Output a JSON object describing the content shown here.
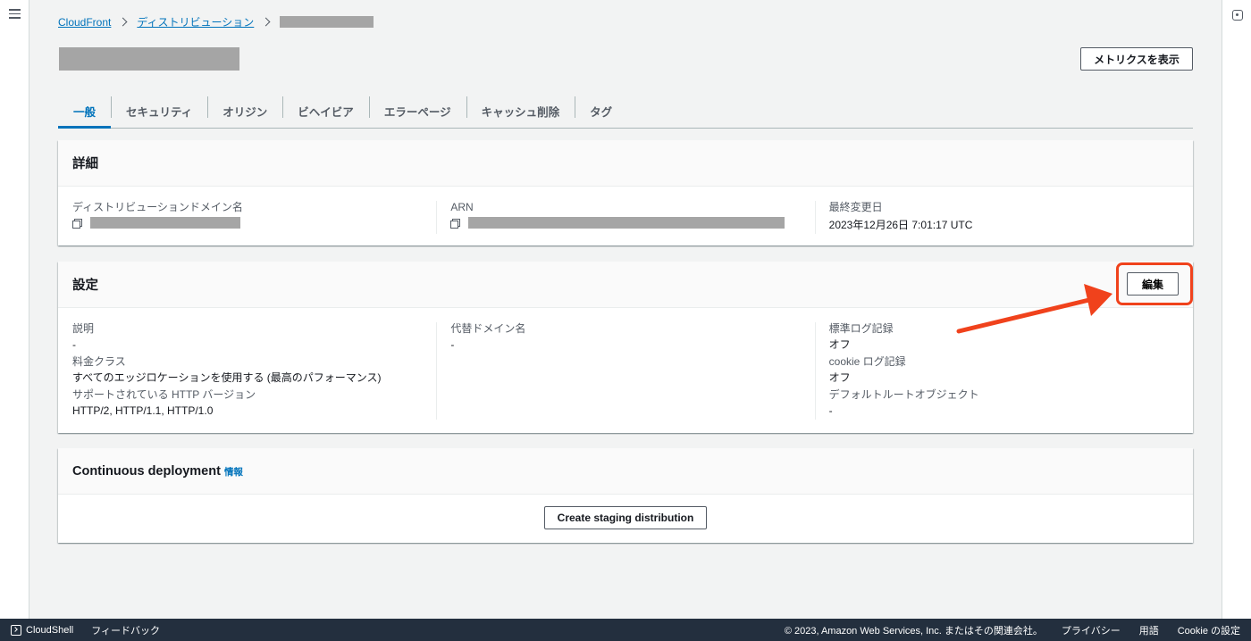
{
  "breadcrumb": {
    "root": "CloudFront",
    "section": "ディストリビューション"
  },
  "header": {
    "metrics_button": "メトリクスを表示"
  },
  "tabs": [
    {
      "label": "一般"
    },
    {
      "label": "セキュリティ"
    },
    {
      "label": "オリジン"
    },
    {
      "label": "ビヘイビア"
    },
    {
      "label": "エラーページ"
    },
    {
      "label": "キャッシュ削除"
    },
    {
      "label": "タグ"
    }
  ],
  "details": {
    "title": "詳細",
    "domain_label": "ディストリビューションドメイン名",
    "arn_label": "ARN",
    "modified_label": "最終変更日",
    "modified_value": "2023年12月26日 7:01:17 UTC"
  },
  "settings": {
    "title": "設定",
    "edit_button": "編集",
    "description_label": "説明",
    "description_value": "-",
    "price_class_label": "料金クラス",
    "price_class_value": "すべてのエッジロケーションを使用する (最高のパフォーマンス)",
    "http_label": "サポートされている HTTP バージョン",
    "http_value": "HTTP/2, HTTP/1.1, HTTP/1.0",
    "cname_label": "代替ドメイン名",
    "cname_value": "-",
    "std_log_label": "標準ログ記録",
    "std_log_value": "オフ",
    "cookie_log_label": "cookie ログ記録",
    "cookie_log_value": "オフ",
    "root_obj_label": "デフォルトルートオブジェクト",
    "root_obj_value": "-"
  },
  "continuous": {
    "title": "Continuous deployment",
    "info": "情報",
    "staging_button": "Create staging distribution"
  },
  "footer": {
    "cloudshell": "CloudShell",
    "feedback": "フィードバック",
    "copyright": "© 2023, Amazon Web Services, Inc. またはその関連会社。",
    "privacy": "プライバシー",
    "terms": "用語",
    "cookie": "Cookie の設定"
  },
  "colors": {
    "accent": "#0073bb",
    "annotation": "#f0421c",
    "footer_bg": "#232f3e"
  }
}
